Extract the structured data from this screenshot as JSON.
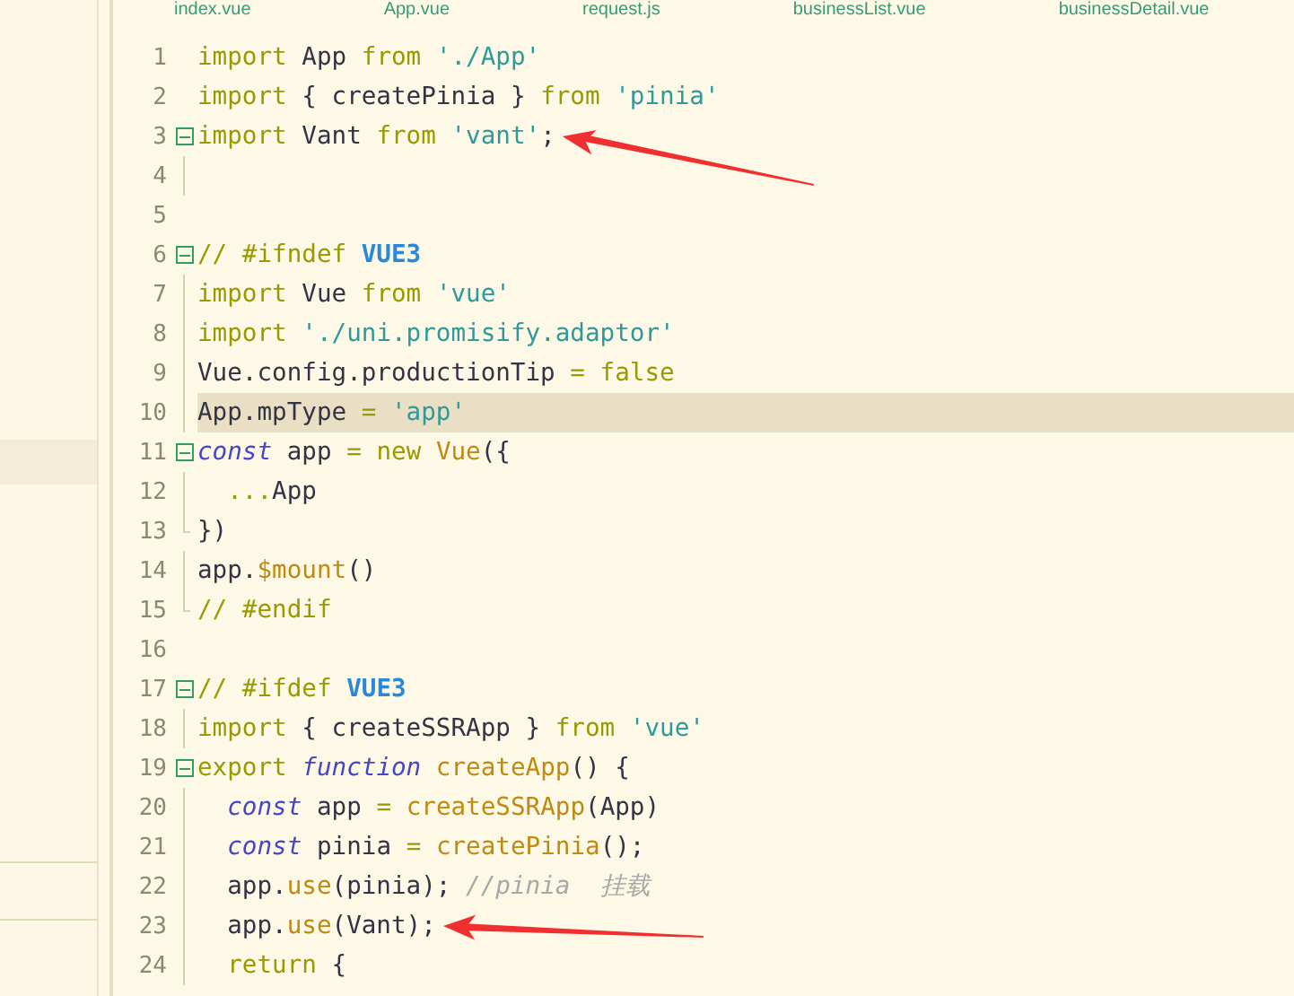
{
  "tabs": [
    {
      "label": "index.vue"
    },
    {
      "label": "App.vue"
    },
    {
      "label": "request.js"
    },
    {
      "label": "businessList.vue"
    },
    {
      "label": "businessDetail.vue"
    }
  ],
  "lines": [
    {
      "number": "1",
      "kind": "plain",
      "current": false,
      "arrow": false,
      "tokens": [
        {
          "kind": "keyword",
          "text": "import"
        },
        {
          "kind": "plain",
          "text": " App "
        },
        {
          "kind": "keyword",
          "text": "from "
        },
        {
          "kind": "string",
          "text": "'./App'"
        }
      ]
    },
    {
      "number": "2",
      "kind": "plain",
      "current": false,
      "arrow": false,
      "tokens": [
        {
          "kind": "keyword",
          "text": "import"
        },
        {
          "kind": "plain",
          "text": " { createPinia } "
        },
        {
          "kind": "keyword",
          "text": "from "
        },
        {
          "kind": "string",
          "text": "'pinia'"
        }
      ]
    },
    {
      "number": "3",
      "kind": "start",
      "current": false,
      "arrow": true,
      "tokens": [
        {
          "kind": "keyword",
          "text": "import"
        },
        {
          "kind": "plain",
          "text": " Vant "
        },
        {
          "kind": "keyword",
          "text": "from "
        },
        {
          "kind": "string",
          "text": "'vant'"
        },
        {
          "kind": "plain",
          "text": ";"
        }
      ]
    },
    {
      "number": "4",
      "kind": "body",
      "current": false,
      "arrow": false
    },
    {
      "number": "5",
      "kind": "plain",
      "current": false,
      "arrow": false
    },
    {
      "number": "6",
      "kind": "start",
      "current": false,
      "arrow": false,
      "tokens": [
        {
          "kind": "comment",
          "text": "// #ifndef "
        },
        {
          "kind": "macro",
          "text": "VUE3"
        }
      ]
    },
    {
      "number": "7",
      "kind": "body",
      "current": false,
      "arrow": false,
      "tokens": [
        {
          "kind": "keyword",
          "text": "import"
        },
        {
          "kind": "plain",
          "text": " Vue "
        },
        {
          "kind": "keyword",
          "text": "from "
        },
        {
          "kind": "string",
          "text": "'vue'"
        }
      ]
    },
    {
      "number": "8",
      "kind": "body",
      "current": false,
      "arrow": false,
      "tokens": [
        {
          "kind": "keyword",
          "text": "import "
        },
        {
          "kind": "string",
          "text": "'./uni.promisify.adaptor'"
        }
      ]
    },
    {
      "number": "9",
      "kind": "body",
      "current": false,
      "arrow": false,
      "tokens": [
        {
          "kind": "plain",
          "text": "Vue.config.productionTip "
        },
        {
          "kind": "keyword",
          "text": "= false"
        }
      ]
    },
    {
      "number": "10",
      "kind": "body",
      "current": true,
      "arrow": false,
      "tokens": [
        {
          "kind": "plain",
          "text": "App.mpType "
        },
        {
          "kind": "keyword",
          "text": "= "
        },
        {
          "kind": "string",
          "text": "'app'"
        }
      ]
    },
    {
      "number": "11",
      "kind": "start",
      "current": false,
      "arrow": false,
      "tokens": [
        {
          "kind": "storage",
          "text": "const"
        },
        {
          "kind": "plain",
          "text": " app "
        },
        {
          "kind": "keyword",
          "text": "= new "
        },
        {
          "kind": "call",
          "text": "Vue"
        },
        {
          "kind": "plain",
          "text": "({"
        }
      ]
    },
    {
      "number": "12",
      "kind": "body",
      "current": false,
      "arrow": false,
      "tokens": [
        {
          "kind": "keyword",
          "text": "  ..."
        },
        {
          "kind": "plain",
          "text": "App"
        }
      ]
    },
    {
      "number": "13",
      "kind": "end",
      "current": false,
      "arrow": false,
      "tokens": [
        {
          "kind": "plain",
          "text": "})"
        }
      ]
    },
    {
      "number": "14",
      "kind": "body",
      "current": false,
      "arrow": false,
      "tokens": [
        {
          "kind": "plain",
          "text": "app."
        },
        {
          "kind": "call",
          "text": "$mount"
        },
        {
          "kind": "plain",
          "text": "()"
        }
      ]
    },
    {
      "number": "15",
      "kind": "end",
      "current": false,
      "arrow": false,
      "tokens": [
        {
          "kind": "comment",
          "text": "// #endif"
        }
      ]
    },
    {
      "number": "16",
      "kind": "plain",
      "current": false,
      "arrow": false
    },
    {
      "number": "17",
      "kind": "start",
      "current": false,
      "arrow": false,
      "tokens": [
        {
          "kind": "comment",
          "text": "// #ifdef "
        },
        {
          "kind": "macro",
          "text": "VUE3"
        }
      ]
    },
    {
      "number": "18",
      "kind": "body",
      "current": false,
      "arrow": false,
      "tokens": [
        {
          "kind": "keyword",
          "text": "import"
        },
        {
          "kind": "plain",
          "text": " { createSSRApp } "
        },
        {
          "kind": "keyword",
          "text": "from "
        },
        {
          "kind": "string",
          "text": "'vue'"
        }
      ]
    },
    {
      "number": "19",
      "kind": "start",
      "current": false,
      "arrow": false,
      "tokens": [
        {
          "kind": "keyword",
          "text": "export "
        },
        {
          "kind": "storage",
          "text": "function "
        },
        {
          "kind": "call",
          "text": "createApp"
        },
        {
          "kind": "plain",
          "text": "() {"
        }
      ]
    },
    {
      "number": "20",
      "kind": "body",
      "current": false,
      "arrow": false,
      "tokens": [
        {
          "kind": "storage",
          "text": "  const"
        },
        {
          "kind": "plain",
          "text": " app "
        },
        {
          "kind": "keyword",
          "text": "= "
        },
        {
          "kind": "call",
          "text": "createSSRApp"
        },
        {
          "kind": "plain",
          "text": "(App)"
        }
      ]
    },
    {
      "number": "21",
      "kind": "body",
      "current": false,
      "arrow": false,
      "tokens": [
        {
          "kind": "storage",
          "text": "  const"
        },
        {
          "kind": "plain",
          "text": " pinia "
        },
        {
          "kind": "keyword",
          "text": "= "
        },
        {
          "kind": "call",
          "text": "createPinia"
        },
        {
          "kind": "plain",
          "text": "();"
        }
      ]
    },
    {
      "number": "22",
      "kind": "body",
      "current": false,
      "arrow": false,
      "tokens": [
        {
          "kind": "plain",
          "text": "  app."
        },
        {
          "kind": "call",
          "text": "use"
        },
        {
          "kind": "plain",
          "text": "(pinia); "
        },
        {
          "kind": "note",
          "text": "//pinia  挂载"
        }
      ]
    },
    {
      "number": "23",
      "kind": "body",
      "current": false,
      "arrow": true,
      "tokens": [
        {
          "kind": "plain",
          "text": "  app."
        },
        {
          "kind": "call",
          "text": "use"
        },
        {
          "kind": "plain",
          "text": "(Vant);"
        }
      ]
    },
    {
      "number": "24",
      "kind": "body",
      "current": false,
      "arrow": false,
      "tokens": [
        {
          "kind": "keyword",
          "text": "  return"
        },
        {
          "kind": "plain",
          "text": " {"
        }
      ]
    }
  ]
}
